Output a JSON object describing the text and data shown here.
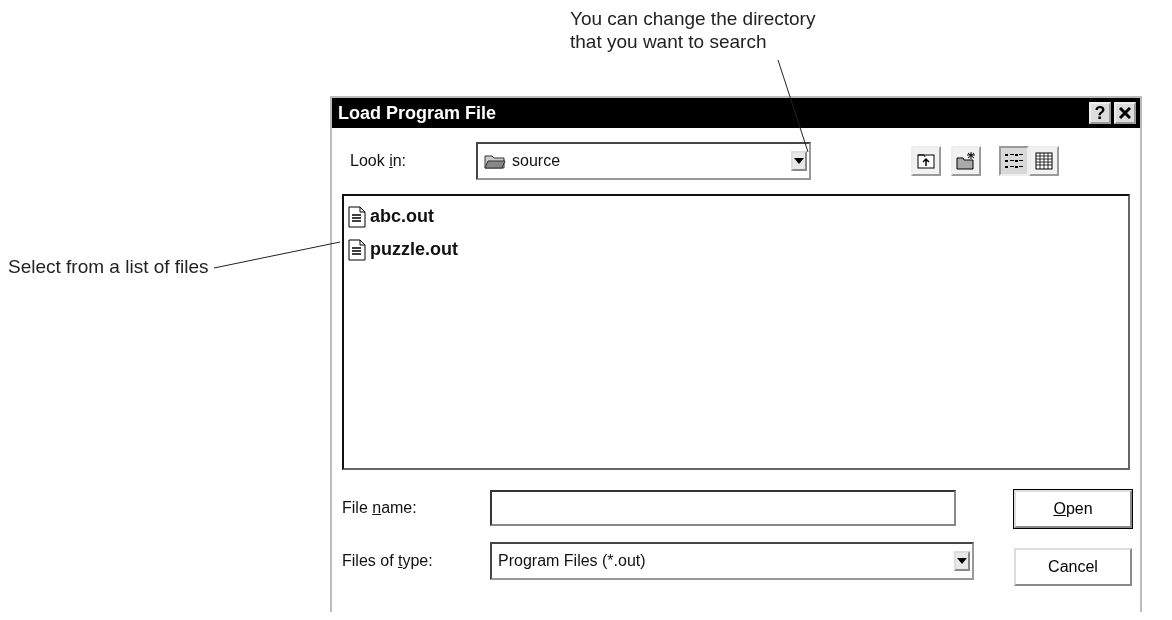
{
  "annotations": [
    {
      "kind": "top",
      "text": "You can change the directory that you want to search"
    },
    {
      "kind": "left",
      "text": "Select from a list of files"
    }
  ],
  "dialog": {
    "title": "Load Program File",
    "title_buttons": [
      {
        "kind": "help",
        "glyph": "?"
      },
      {
        "kind": "close"
      }
    ],
    "look_in": {
      "label": {
        "pre": "Look ",
        "key": "i",
        "post": "n:"
      },
      "value": "source"
    },
    "toolbar": [
      {
        "kind": "up-folder",
        "selected": false
      },
      {
        "kind": "new-folder",
        "selected": false
      },
      {
        "kind": "list-view",
        "selected": true
      },
      {
        "kind": "details-view",
        "selected": false
      }
    ],
    "files": [
      {
        "name": "abc.out",
        "selected": false
      },
      {
        "name": "puzzle.out",
        "selected": false
      }
    ],
    "file_name": {
      "label": {
        "pre": "File ",
        "key": "n",
        "post": "ame:"
      }
    },
    "file_type": {
      "label": {
        "pre": "Files of ",
        "key": "t",
        "post": "ype:"
      },
      "value": "Program Files (*.out)"
    },
    "buttons": [
      {
        "label": {
          "key": "O",
          "post": "pen"
        },
        "default": true
      },
      {
        "label": {
          "pre": "Cancel"
        },
        "default": false
      }
    ]
  }
}
